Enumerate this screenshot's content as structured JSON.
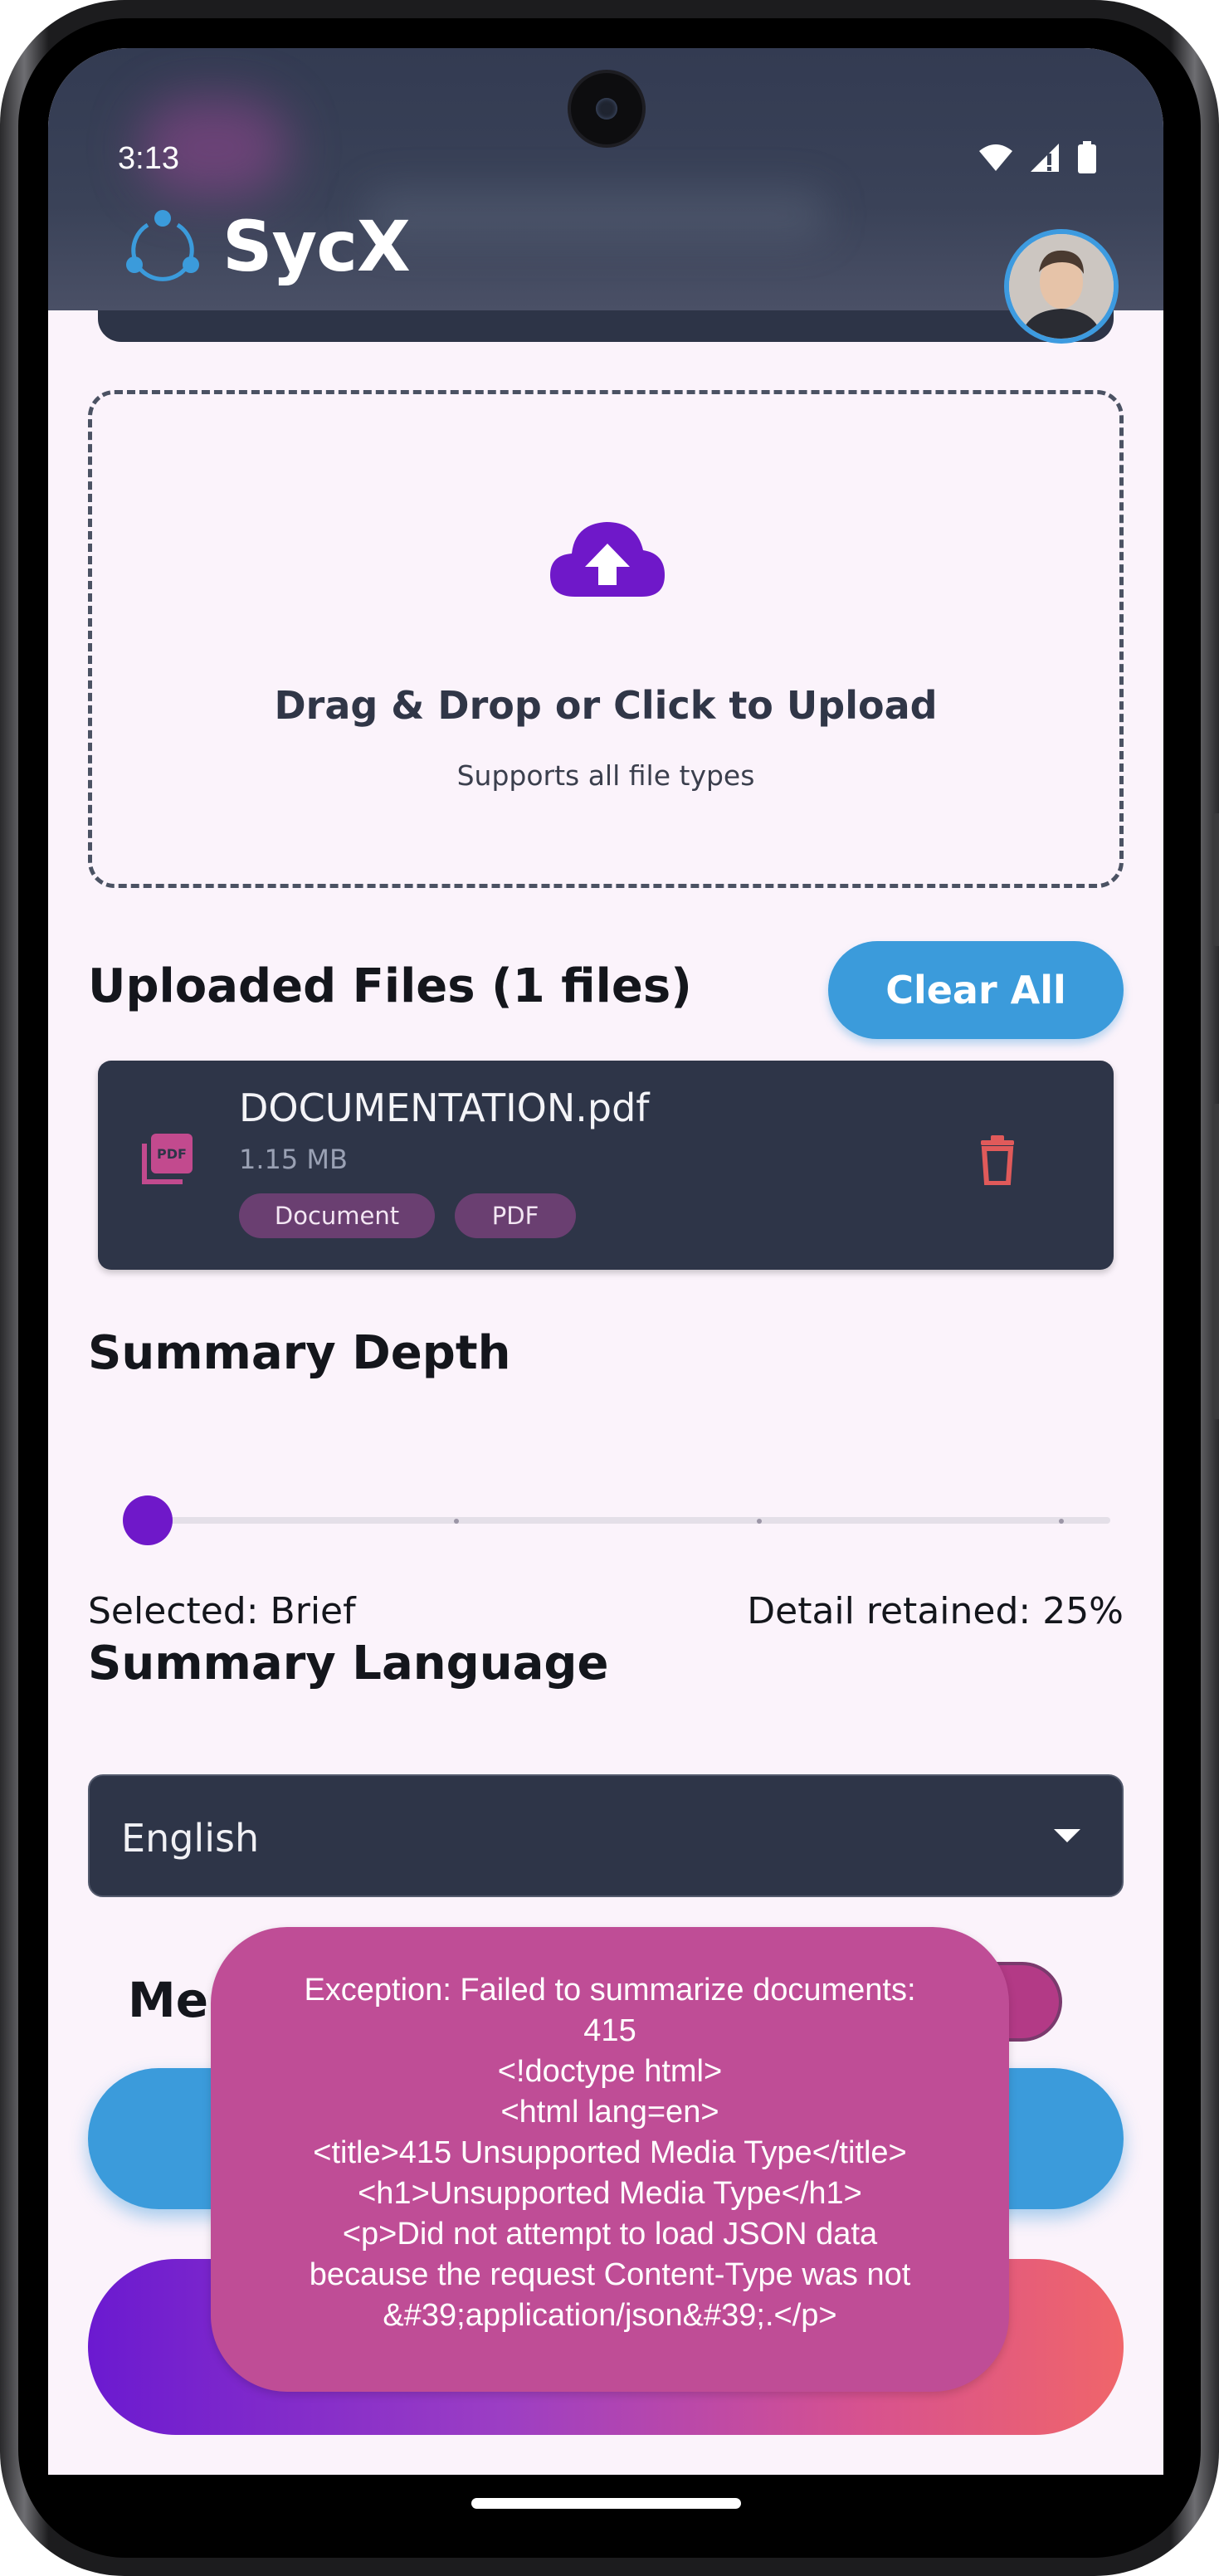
{
  "status_bar": {
    "time": "3:13"
  },
  "header": {
    "app_name": "SycX"
  },
  "upload": {
    "title": "Drag & Drop or Click to Upload",
    "subtitle": "Supports all file types"
  },
  "files": {
    "heading": "Uploaded Files (1 files)",
    "clear_label": "Clear All",
    "items": [
      {
        "name": "DOCUMENTATION.pdf",
        "size": "1.15 MB",
        "tags": [
          "Document",
          "PDF"
        ]
      }
    ]
  },
  "depth": {
    "heading": "Summary Depth",
    "selected": "Selected: Brief",
    "retained": "Detail retained: 25%",
    "level": 0
  },
  "language": {
    "heading": "Summary Language",
    "value": "English"
  },
  "merge": {
    "label_visible": "Mer"
  },
  "toast": {
    "message": "Exception: Failed to summarize documents:\n415\n<!doctype html>\n<html lang=en>\n<title>415 Unsupported Media Type</title>\n<h1>Unsupported Media Type</h1>\n<p>Did not attempt to load JSON data\nbecause the request Content-Type was not\n&#39;application/json&#39;.</p>"
  },
  "colors": {
    "accent_blue": "#3b9bdb",
    "accent_purple": "#6f18c9",
    "card_dark": "#2e3548",
    "toast": "#bf4d96",
    "danger": "#e05a5a"
  }
}
